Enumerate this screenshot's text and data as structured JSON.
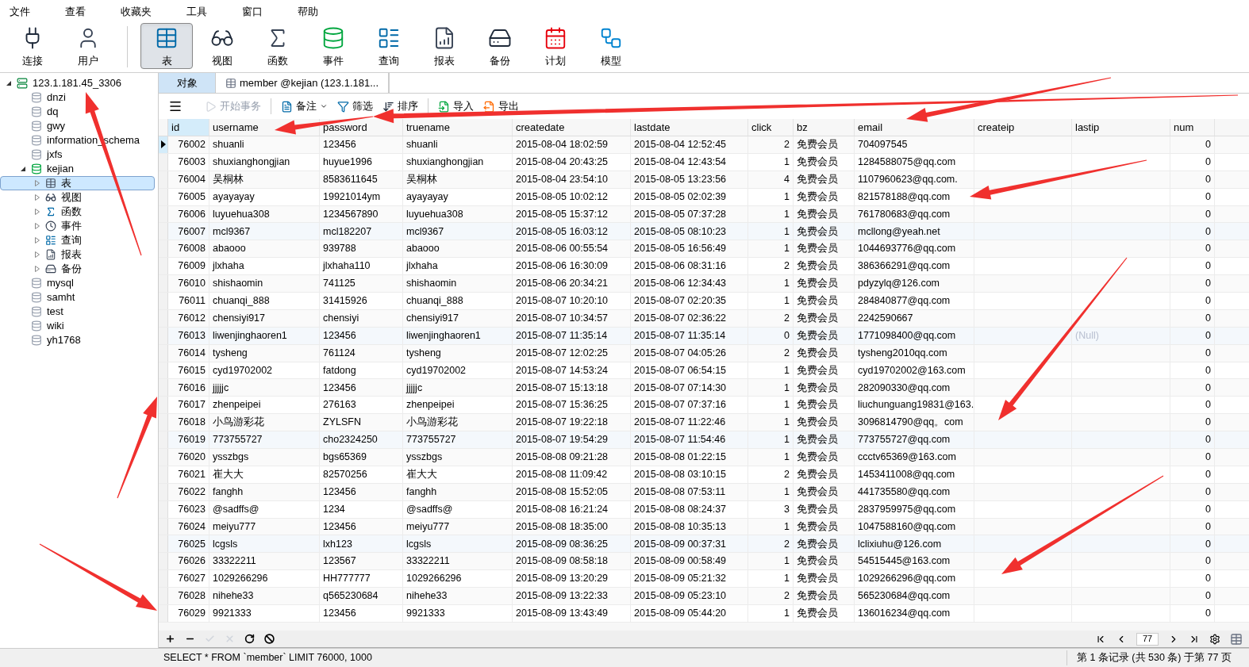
{
  "menu": [
    "文件",
    "查看",
    "收藏夹",
    "工具",
    "窗口",
    "帮助"
  ],
  "toolbar": [
    {
      "label": "连接",
      "selected": false
    },
    {
      "label": "用户",
      "selected": false
    },
    {
      "label": "表",
      "selected": true
    },
    {
      "label": "视图",
      "selected": false
    },
    {
      "label": "函数",
      "selected": false
    },
    {
      "label": "事件",
      "selected": false
    },
    {
      "label": "查询",
      "selected": false
    },
    {
      "label": "报表",
      "selected": false
    },
    {
      "label": "备份",
      "selected": false
    },
    {
      "label": "计划",
      "selected": false
    },
    {
      "label": "模型",
      "selected": false
    }
  ],
  "tree": [
    {
      "label": "123.1.181.45_3306",
      "kind": "server",
      "expanded": true,
      "selected": false,
      "children": [
        {
          "label": "dnzi",
          "kind": "database",
          "selected": false
        },
        {
          "label": "dq",
          "kind": "database",
          "selected": false
        },
        {
          "label": "gwy",
          "kind": "database",
          "selected": false
        },
        {
          "label": "information_schema",
          "kind": "database",
          "selected": false
        },
        {
          "label": "jxfs",
          "kind": "database",
          "selected": false
        },
        {
          "label": "kejian",
          "kind": "open-database",
          "expanded": true,
          "selected": false,
          "children": [
            {
              "label": "表",
              "kind": "table",
              "expanded": false,
              "selected": true
            },
            {
              "label": "视图",
              "kind": "view",
              "expanded": false,
              "selected": false
            },
            {
              "label": "函数",
              "kind": "function",
              "expanded": false,
              "selected": false
            },
            {
              "label": "事件",
              "kind": "event",
              "expanded": false,
              "selected": false
            },
            {
              "label": "查询",
              "kind": "query",
              "expanded": false,
              "selected": false
            },
            {
              "label": "报表",
              "kind": "report",
              "expanded": false,
              "selected": false
            },
            {
              "label": "备份",
              "kind": "backup",
              "expanded": false,
              "selected": false
            }
          ]
        },
        {
          "label": "mysql",
          "kind": "database",
          "selected": false
        },
        {
          "label": "samht",
          "kind": "database",
          "selected": false
        },
        {
          "label": "test",
          "kind": "database",
          "selected": false
        },
        {
          "label": "wiki",
          "kind": "database",
          "selected": false
        },
        {
          "label": "yh1768",
          "kind": "database",
          "selected": false
        }
      ]
    }
  ],
  "tabs": [
    {
      "label": "对象",
      "selected": true
    },
    {
      "label": "member @kejian (123.1.181...",
      "selected": false
    }
  ],
  "actions": [
    {
      "label": "开始事务",
      "disabled": true
    },
    {
      "label": "备注",
      "disabled": false
    },
    {
      "label": "筛选",
      "disabled": false
    },
    {
      "label": "排序",
      "disabled": false
    },
    {
      "label": "导入",
      "disabled": false
    },
    {
      "label": "导出",
      "disabled": false
    }
  ],
  "table": {
    "columns": [
      "id",
      "username",
      "password",
      "truename",
      "createdate",
      "lastdate",
      "click",
      "bz",
      "email",
      "createip",
      "lastip",
      "num"
    ],
    "rows": [
      {
        "current": true,
        "cells": [
          "76002",
          "shuanli",
          "123456",
          "shuanli",
          "2015-08-04 18:02:59",
          "2015-08-04 12:52:45",
          "2",
          "免费会员",
          "704097545",
          null,
          null,
          "0"
        ]
      },
      {
        "current": false,
        "cells": [
          "76003",
          "shuxianghongjian",
          "huyue1996",
          "shuxianghongjian",
          "2015-08-04 20:43:25",
          "2015-08-04 12:43:54",
          "1",
          "免费会员",
          "1284588075@qq.com",
          null,
          null,
          "0"
        ]
      },
      {
        "current": false,
        "cells": [
          "76004",
          "吴桐林",
          "8583611645",
          "吴桐林",
          "2015-08-04 23:54:10",
          "2015-08-05 13:23:56",
          "4",
          "免费会员",
          "1107960623@qq.com.",
          null,
          null,
          "0"
        ]
      },
      {
        "current": false,
        "cells": [
          "76005",
          "ayayayay",
          "19921014ym",
          "ayayayay",
          "2015-08-05 10:02:12",
          "2015-08-05 02:02:39",
          "1",
          "免费会员",
          "821578188@qq.com",
          null,
          null,
          "0"
        ]
      },
      {
        "current": false,
        "cells": [
          "76006",
          "luyuehua308",
          "1234567890",
          "luyuehua308",
          "2015-08-05 15:37:12",
          "2015-08-05 07:37:28",
          "1",
          "免费会员",
          "761780683@qq.com",
          null,
          null,
          "0"
        ]
      },
      {
        "current": false,
        "cells": [
          "76007",
          "mcl9367",
          "mcl182207",
          "mcl9367",
          "2015-08-05 16:03:12",
          "2015-08-05 08:10:23",
          "1",
          "免费会员",
          "mcllong@yeah.net",
          null,
          null,
          "0"
        ]
      },
      {
        "current": false,
        "cells": [
          "76008",
          "abaooo",
          "939788",
          "abaooo",
          "2015-08-06 00:55:54",
          "2015-08-05 16:56:49",
          "1",
          "免费会员",
          "1044693776@qq.com",
          null,
          null,
          "0"
        ]
      },
      {
        "current": false,
        "cells": [
          "76009",
          "jlxhaha",
          "jlxhaha110",
          "jlxhaha",
          "2015-08-06 16:30:09",
          "2015-08-06 08:31:16",
          "2",
          "免费会员",
          "386366291@qq.com",
          null,
          null,
          "0"
        ]
      },
      {
        "current": false,
        "cells": [
          "76010",
          "shishaomin",
          "741125",
          "shishaomin",
          "2015-08-06 20:34:21",
          "2015-08-06 12:34:43",
          "1",
          "免费会员",
          "pdyzylq@126.com",
          null,
          null,
          "0"
        ]
      },
      {
        "current": false,
        "cells": [
          "76011",
          "chuanqi_888",
          "31415926",
          "chuanqi_888",
          "2015-08-07 10:20:10",
          "2015-08-07 02:20:35",
          "1",
          "免费会员",
          "284840877@qq.com",
          null,
          null,
          "0"
        ]
      },
      {
        "current": false,
        "cells": [
          "76012",
          "chensiyi917",
          "chensiyi",
          "chensiyi917",
          "2015-08-07 10:34:57",
          "2015-08-07 02:36:22",
          "2",
          "免费会员",
          "2242590667",
          null,
          null,
          "0"
        ]
      },
      {
        "current": false,
        "cells": [
          "76013",
          "liwenjinghaoren1",
          "123456",
          "liwenjinghaoren1",
          "2015-08-07 11:35:14",
          "2015-08-07 11:35:14",
          "0",
          "免费会员",
          "1771098400@qq.com",
          null,
          {
            "text": "(Null)",
            "kind": "null"
          },
          "0"
        ]
      },
      {
        "current": false,
        "cells": [
          "76014",
          "tysheng",
          "761124",
          "tysheng",
          "2015-08-07 12:02:25",
          "2015-08-07 04:05:26",
          "2",
          "免费会员",
          "tysheng2010qq.com",
          null,
          null,
          "0"
        ]
      },
      {
        "current": false,
        "cells": [
          "76015",
          "cyd19702002",
          "fatdong",
          "cyd19702002",
          "2015-08-07 14:53:24",
          "2015-08-07 06:54:15",
          "1",
          "免费会员",
          "cyd19702002@163.com",
          null,
          null,
          "0"
        ]
      },
      {
        "current": false,
        "cells": [
          "76016",
          "jjjjjc",
          "123456",
          "jjjjjc",
          "2015-08-07 15:13:18",
          "2015-08-07 07:14:30",
          "1",
          "免费会员",
          "282090330@qq.com",
          null,
          null,
          "0"
        ]
      },
      {
        "current": false,
        "cells": [
          "76017",
          "zhenpeipei",
          "276163",
          "zhenpeipei",
          "2015-08-07 15:36:25",
          "2015-08-07 07:37:16",
          "1",
          "免费会员",
          "liuchunguang19831@163.",
          null,
          null,
          "0"
        ]
      },
      {
        "current": false,
        "cells": [
          "76018",
          "小鸟游彩花",
          "ZYLSFN",
          "小鸟游彩花",
          "2015-08-07 19:22:18",
          "2015-08-07 11:22:46",
          "1",
          "免费会员",
          "3096814790@qq。com",
          null,
          null,
          "0"
        ]
      },
      {
        "current": false,
        "cells": [
          "76019",
          "773755727",
          "cho2324250",
          "773755727",
          "2015-08-07 19:54:29",
          "2015-08-07 11:54:46",
          "1",
          "免费会员",
          "773755727@qq.com",
          null,
          null,
          "0"
        ]
      },
      {
        "current": false,
        "cells": [
          "76020",
          "ysszbgs",
          "bgs65369",
          "ysszbgs",
          "2015-08-08 09:21:28",
          "2015-08-08 01:22:15",
          "1",
          "免费会员",
          "ccctv65369@163.com",
          null,
          null,
          "0"
        ]
      },
      {
        "current": false,
        "cells": [
          "76021",
          "崔大大",
          "82570256",
          "崔大大",
          "2015-08-08 11:09:42",
          "2015-08-08 03:10:15",
          "2",
          "免费会员",
          "1453411008@qq.com",
          null,
          null,
          "0"
        ]
      },
      {
        "current": false,
        "cells": [
          "76022",
          "fanghh",
          "123456",
          "fanghh",
          "2015-08-08 15:52:05",
          "2015-08-08 07:53:11",
          "1",
          "免费会员",
          "441735580@qq.com",
          null,
          null,
          "0"
        ]
      },
      {
        "current": false,
        "cells": [
          "76023",
          "@sadffs@",
          "1234",
          "@sadffs@",
          "2015-08-08 16:21:24",
          "2015-08-08 08:24:37",
          "3",
          "免费会员",
          "2837959975@qq.com",
          null,
          null,
          "0"
        ]
      },
      {
        "current": false,
        "cells": [
          "76024",
          "meiyu777",
          "123456",
          "meiyu777",
          "2015-08-08 18:35:00",
          "2015-08-08 10:35:13",
          "1",
          "免费会员",
          "1047588160@qq.com",
          null,
          null,
          "0"
        ]
      },
      {
        "current": false,
        "cells": [
          "76025",
          "lcgsls",
          "lxh123",
          "lcgsls",
          "2015-08-09 08:36:25",
          "2015-08-09 00:37:31",
          "2",
          "免费会员",
          "lclixiuhu@126.com",
          null,
          null,
          "0"
        ]
      },
      {
        "current": false,
        "cells": [
          "76026",
          "33322211",
          "123567",
          "33322211",
          "2015-08-09 08:58:18",
          "2015-08-09 00:58:49",
          "1",
          "免费会员",
          "54515445@163.com",
          null,
          null,
          "0"
        ]
      },
      {
        "current": false,
        "cells": [
          "76027",
          "1029266296",
          "HH777777",
          "1029266296",
          "2015-08-09 13:20:29",
          "2015-08-09 05:21:32",
          "1",
          "免费会员",
          "1029266296@qq.com",
          null,
          null,
          "0"
        ]
      },
      {
        "current": false,
        "cells": [
          "76028",
          "nihehe33",
          "q565230684",
          "nihehe33",
          "2015-08-09 13:22:33",
          "2015-08-09 05:23:10",
          "2",
          "免费会员",
          "565230684@qq.com",
          null,
          null,
          "0"
        ]
      },
      {
        "current": false,
        "cells": [
          "76029",
          "9921333",
          "123456",
          "9921333",
          "2015-08-09 13:43:49",
          "2015-08-09 05:44:20",
          "1",
          "免费会员",
          "136016234@qq.com",
          null,
          null,
          "0"
        ]
      }
    ]
  },
  "page_field": "77",
  "status": {
    "sql": "SELECT * FROM `member` LIMIT 76000, 1000",
    "records": "第 1 条记录 (共 530 条) 于第 77 页"
  }
}
